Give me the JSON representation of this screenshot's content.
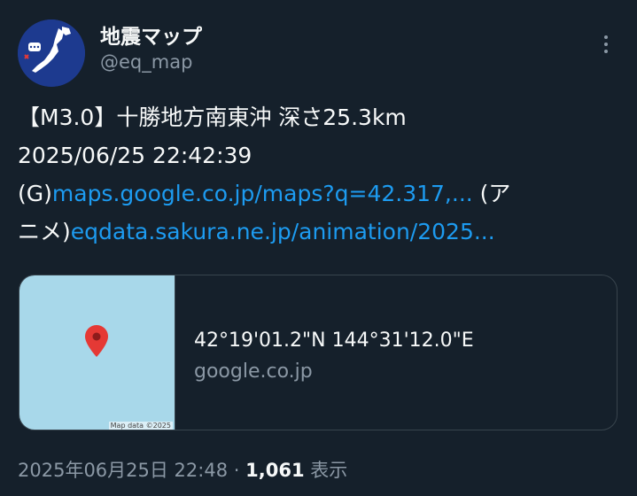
{
  "account": {
    "name": "地震マップ",
    "handle": "@eq_map"
  },
  "tweet": {
    "line1": "【M3.0】十勝地方南東沖 深さ25.3km",
    "line2": "2025/06/25 22:42:39",
    "line3_prefix": "(G)",
    "line3_link": "maps.google.co.jp/maps?q=42.317,...",
    "line3_suffix": " (ア",
    "line4_prefix": "ニメ)",
    "line4_link": "eqdata.sakura.ne.jp/animation/2025..."
  },
  "card": {
    "coordinates": "42°19'01.2\"N 144°31'12.0\"E",
    "domain": "google.co.jp",
    "map_attribution": "Map data ©2025",
    "pin_color": "#e53935"
  },
  "meta": {
    "timestamp": "2025年06月25日 22:48",
    "separator": " · ",
    "view_count": "1,061",
    "views_label": " 表示"
  },
  "colors": {
    "background": "#15202b",
    "link": "#1d9bf0",
    "secondary_text": "#8b98a5",
    "map_water": "#a8d8ea"
  }
}
